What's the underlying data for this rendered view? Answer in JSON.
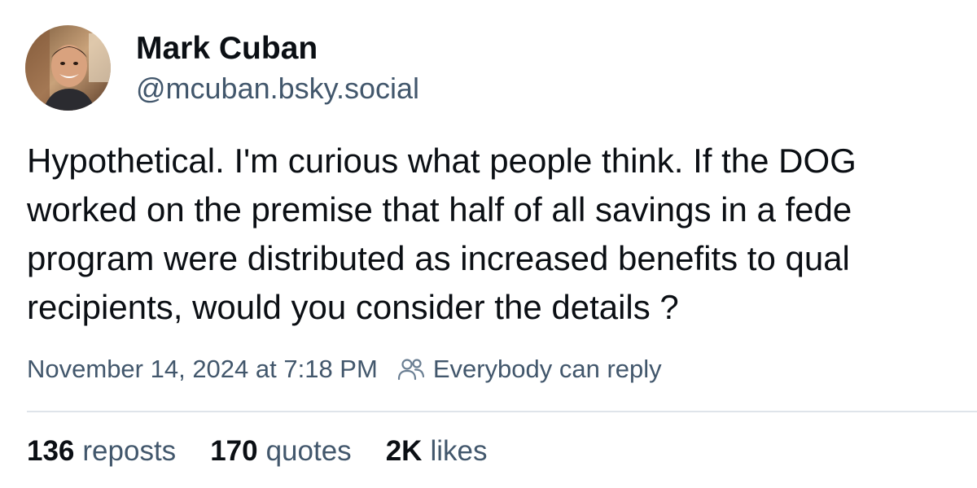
{
  "author": {
    "name": "Mark Cuban",
    "handle": "@mcuban.bsky.social"
  },
  "post": {
    "lines": [
      "Hypothetical. I'm curious what people think. If the DOG",
      "worked on the premise that half of all savings in a fede",
      "program were distributed as increased benefits to qual",
      "recipients, would you consider the details ?"
    ],
    "timestamp": "November 14, 2024 at 7:18 PM",
    "reply_setting": "Everybody can reply",
    "reply_icon": "people-icon"
  },
  "stats": {
    "reposts": {
      "count": "136",
      "label": "reposts"
    },
    "quotes": {
      "count": "170",
      "label": "quotes"
    },
    "likes": {
      "count": "2K",
      "label": "likes"
    }
  },
  "colors": {
    "primary_text": "#0b0f14",
    "secondary_text": "#42576c",
    "divider": "#dfe4ea",
    "background": "#ffffff"
  }
}
